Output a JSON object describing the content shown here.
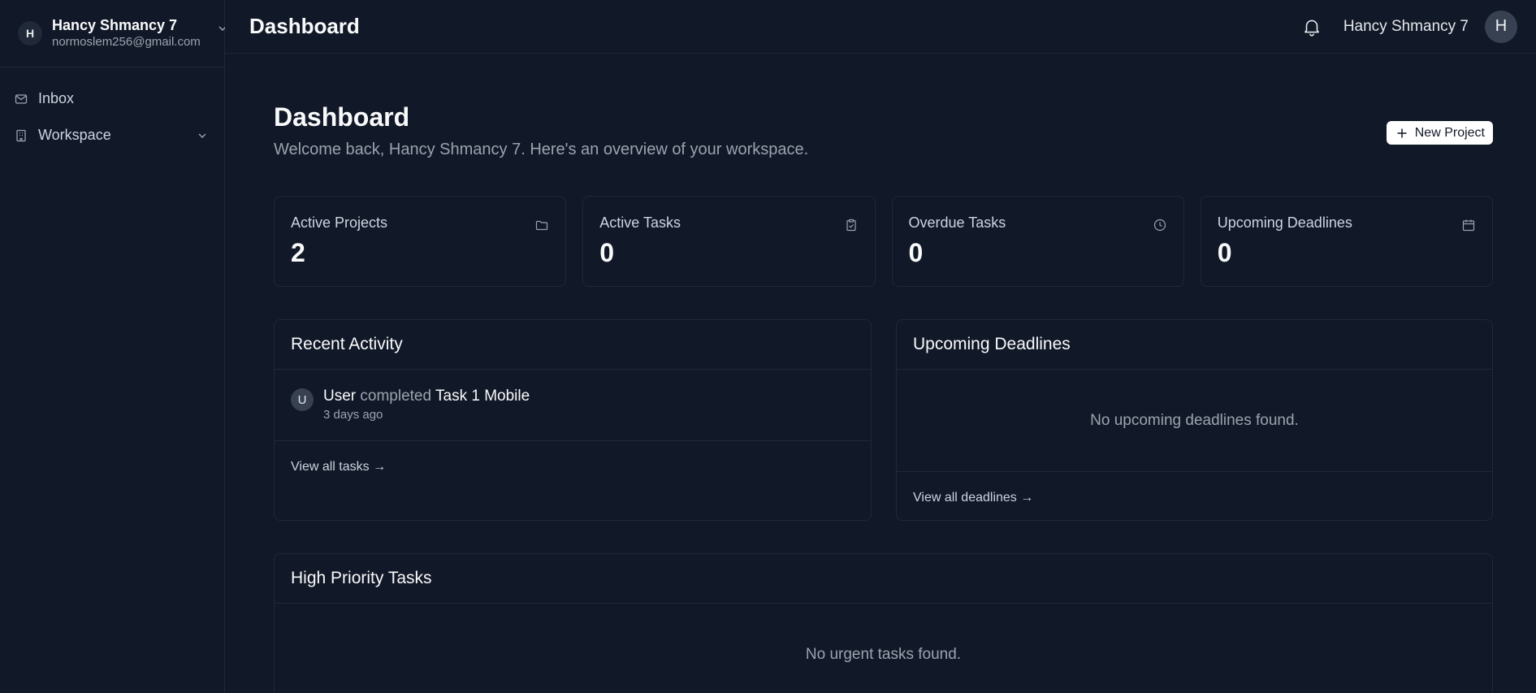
{
  "sidebar": {
    "account": {
      "initial": "H",
      "name": "Hancy Shmancy 7",
      "email": "normoslem256@gmail.com"
    },
    "items": [
      {
        "label": "Inbox",
        "icon": "mail-icon"
      },
      {
        "label": "Workspace",
        "icon": "building-icon"
      }
    ]
  },
  "topbar": {
    "title": "Dashboard",
    "user_name": "Hancy Shmancy 7",
    "avatar_initial": "H"
  },
  "page": {
    "title": "Dashboard",
    "subtitle": "Welcome back, Hancy Shmancy 7. Here's an overview of your workspace.",
    "new_project_label": "New Project"
  },
  "stats": [
    {
      "label": "Active Projects",
      "value": "2",
      "icon": "folder-icon"
    },
    {
      "label": "Active Tasks",
      "value": "0",
      "icon": "clipboard-check-icon"
    },
    {
      "label": "Overdue Tasks",
      "value": "0",
      "icon": "clock-icon"
    },
    {
      "label": "Upcoming Deadlines",
      "value": "0",
      "icon": "calendar-icon"
    }
  ],
  "recent_activity": {
    "title": "Recent Activity",
    "items": [
      {
        "initial": "U",
        "user": "User",
        "verb": "completed",
        "target": "Task 1 Mobile",
        "time": "3 days ago"
      }
    ],
    "link": "View all tasks →"
  },
  "upcoming_deadlines": {
    "title": "Upcoming Deadlines",
    "empty": "No upcoming deadlines found.",
    "link": "View all deadlines →"
  },
  "high_priority": {
    "title": "High Priority Tasks",
    "empty": "No urgent tasks found."
  },
  "colors": {
    "background": "#111827",
    "border": "#1f2937",
    "muted_text": "#9ca3af",
    "primary_text": "#f9fafb"
  }
}
